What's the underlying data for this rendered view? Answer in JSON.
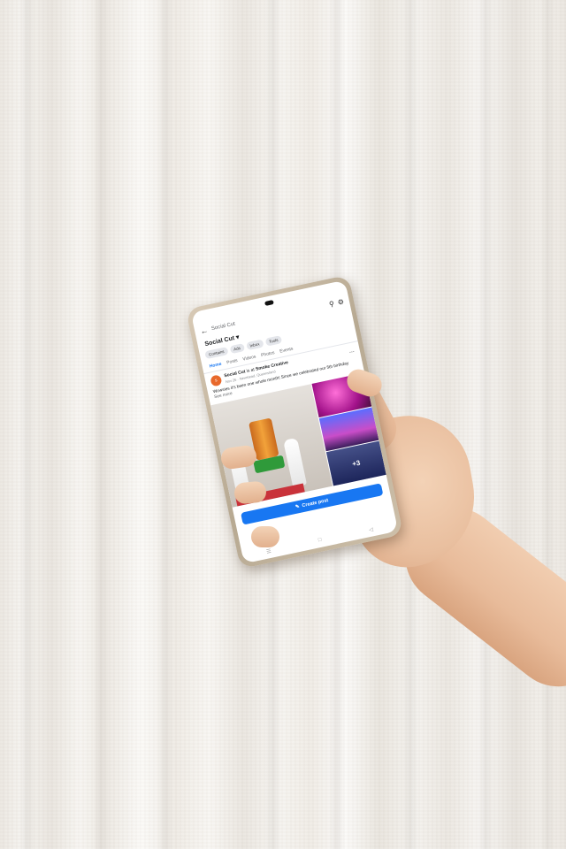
{
  "screen": {
    "status_bar": {
      "time": "",
      "icons": ""
    },
    "topbar": {
      "search_text": "Social Cut"
    },
    "page_name": "Social Cut",
    "chips": [
      "Contains",
      "Ads",
      "Inbox",
      "Tools"
    ],
    "tabs": [
      "Home",
      "Posts",
      "Videos",
      "Photos",
      "Events"
    ],
    "active_tab": "Home",
    "post": {
      "avatar_letter": "s",
      "author": "Social Cut",
      "at_text": "is at",
      "location": "Smoke Creative",
      "subline": "Nov 26 · Newstead, Queensland",
      "text": "Wowsies it's been one whole month! Since we celebrated our 5th birthday",
      "see_more": "See more",
      "extra_photos": "+3"
    },
    "create_post_label": "Create post"
  },
  "colors": {
    "accent": "#1877f2",
    "avatar": "#e8692c"
  },
  "icons": {
    "back": "arrow-left-icon",
    "search": "search-icon",
    "settings": "gear-icon",
    "create": "edit-icon",
    "nav": [
      "menu-icon",
      "home-icon",
      "back-icon"
    ]
  }
}
